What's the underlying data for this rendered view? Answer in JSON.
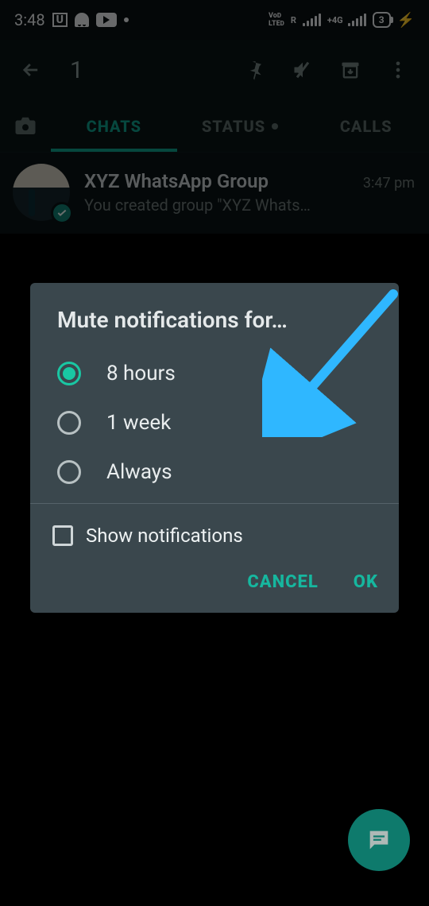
{
  "status": {
    "time": "3:48",
    "r_indicator": "R",
    "battery": "3"
  },
  "toolbar": {
    "selected_count": "1"
  },
  "tabs": {
    "chats": "CHATS",
    "status": "STATUS",
    "calls": "CALLS"
  },
  "chat": {
    "title": "XYZ WhatsApp Group",
    "time": "3:47 pm",
    "subtitle": "You created group \"XYZ Whats…"
  },
  "dialog": {
    "title": "Mute notifications for…",
    "options": {
      "o1": "8 hours",
      "o2": "1 week",
      "o3": "Always"
    },
    "show_notifications": "Show notifications",
    "cancel": "CANCEL",
    "ok": "OK"
  }
}
